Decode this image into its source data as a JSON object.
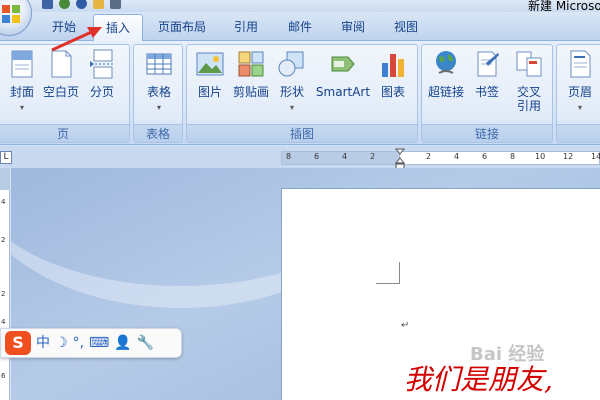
{
  "window": {
    "title": "新建 Microsoft"
  },
  "tabs": [
    {
      "label": "开始"
    },
    {
      "label": "插入",
      "active": true
    },
    {
      "label": "页面布局"
    },
    {
      "label": "引用"
    },
    {
      "label": "邮件"
    },
    {
      "label": "审阅"
    },
    {
      "label": "视图"
    }
  ],
  "groups": {
    "pages": {
      "label": "页",
      "buttons": [
        "封面",
        "空白页",
        "分页"
      ]
    },
    "tables": {
      "label": "表格",
      "buttons": [
        "表格"
      ]
    },
    "illustrations": {
      "label": "插图",
      "buttons": [
        "图片",
        "剪贴画",
        "形状",
        "SmartArt",
        "图表"
      ]
    },
    "links": {
      "label": "链接",
      "buttons": [
        "超链接",
        "书签",
        "交叉",
        "引用"
      ]
    },
    "header_footer": {
      "buttons": [
        "页眉"
      ]
    }
  },
  "ruler": {
    "corner": "L",
    "ticks": [
      "8",
      "6",
      "4",
      "2",
      "2",
      "4",
      "6",
      "8",
      "10",
      "12",
      "14"
    ],
    "vticks": [
      "4",
      "2",
      "2",
      "4",
      "6"
    ]
  },
  "document": {
    "para_mark": "↵",
    "text": "我们是朋友,",
    "watermark": "Bai 经验"
  },
  "ime": {
    "logo": "S",
    "items": [
      "中",
      "☽",
      "°,",
      "⌨",
      "👤",
      "🔧"
    ]
  },
  "colors": {
    "annotation_arrow": "#e0302a",
    "document_text": "#d40000",
    "ime_logo": "#ef4f1f",
    "ribbon_text": "#15428b"
  }
}
